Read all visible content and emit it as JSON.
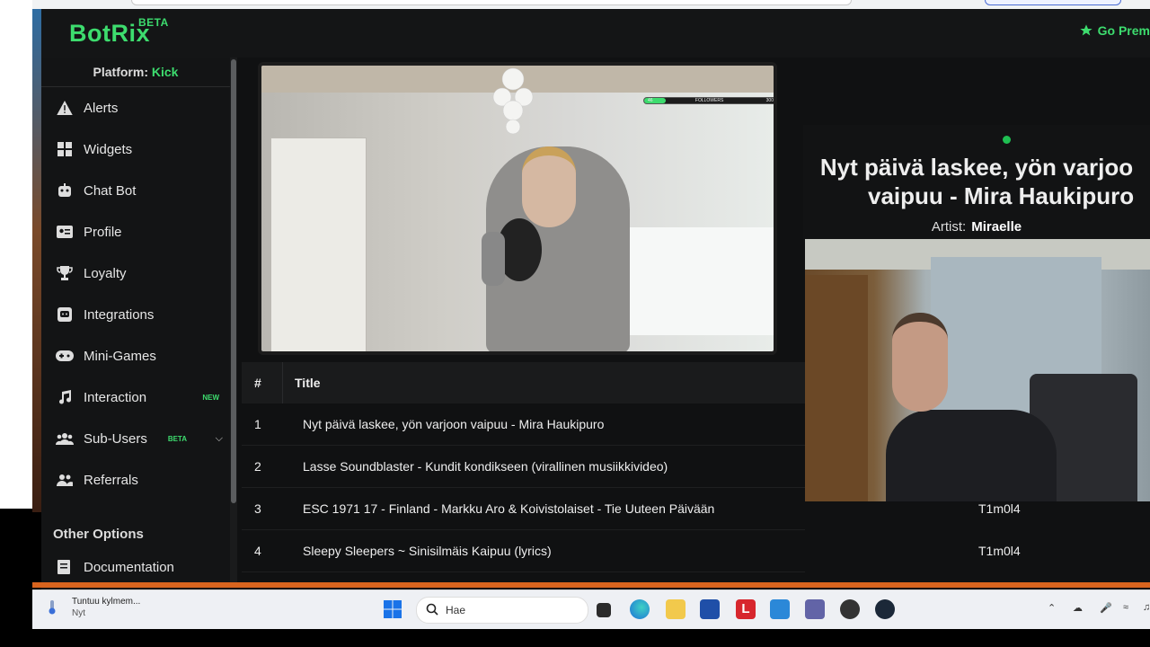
{
  "header": {
    "logo": "BotRix",
    "logo_badge": "BETA",
    "premium_label": "Go Prem"
  },
  "sidebar": {
    "platform_label": "Platform:",
    "platform_value": "Kick",
    "items": [
      {
        "label": "Alerts",
        "icon": "warning-icon"
      },
      {
        "label": "Widgets",
        "icon": "widgets-icon"
      },
      {
        "label": "Chat Bot",
        "icon": "robot-icon"
      },
      {
        "label": "Profile",
        "icon": "id-card-icon"
      },
      {
        "label": "Loyalty",
        "icon": "trophy-icon"
      },
      {
        "label": "Integrations",
        "icon": "discord-icon"
      },
      {
        "label": "Mini-Games",
        "icon": "gamepad-icon"
      },
      {
        "label": "Interaction",
        "icon": "music-icon",
        "badge": "NEW"
      },
      {
        "label": "Sub-Users",
        "icon": "users-icon",
        "badge": "BETA"
      },
      {
        "label": "Referrals",
        "icon": "user-group-icon"
      }
    ],
    "other_options": "Other Options",
    "documentation": "Documentation"
  },
  "overlay": {
    "followers_left": "46",
    "followers_label": "FOLLOWERS",
    "followers_right": "300"
  },
  "now_playing": {
    "title_line1": "Nyt päivä laskee, yön varjoo",
    "title_line2": "vaipuu - Mira Haukipuro",
    "artist_label": "Artist:",
    "artist": "Miraelle"
  },
  "table": {
    "columns": [
      "#",
      "Title"
    ],
    "rows": [
      {
        "num": "1",
        "title": "Nyt päivä laskee, yön varjoon vaipuu - Mira Haukipuro",
        "user": ""
      },
      {
        "num": "2",
        "title": "Lasse Soundblaster - Kundit kondikseen (virallinen musiikkivideo)",
        "user": ""
      },
      {
        "num": "3",
        "title": "ESC 1971 17 - Finland - Markku Aro & Koivistolaiset - Tie Uuteen Päivään",
        "user": "T1m0l4"
      },
      {
        "num": "4",
        "title": "Sleepy Sleepers ~ Sinisilmäis Kaipuu (lyrics)",
        "user": "T1m0l4"
      }
    ]
  },
  "taskbar": {
    "weather_title": "Tuntuu kylmem...",
    "weather_sub": "Nyt",
    "search_placeholder": "Hae"
  },
  "colors": {
    "accent": "#3ddc6e",
    "app_bg": "#111213",
    "taskbar_bg": "#eef0f4"
  }
}
